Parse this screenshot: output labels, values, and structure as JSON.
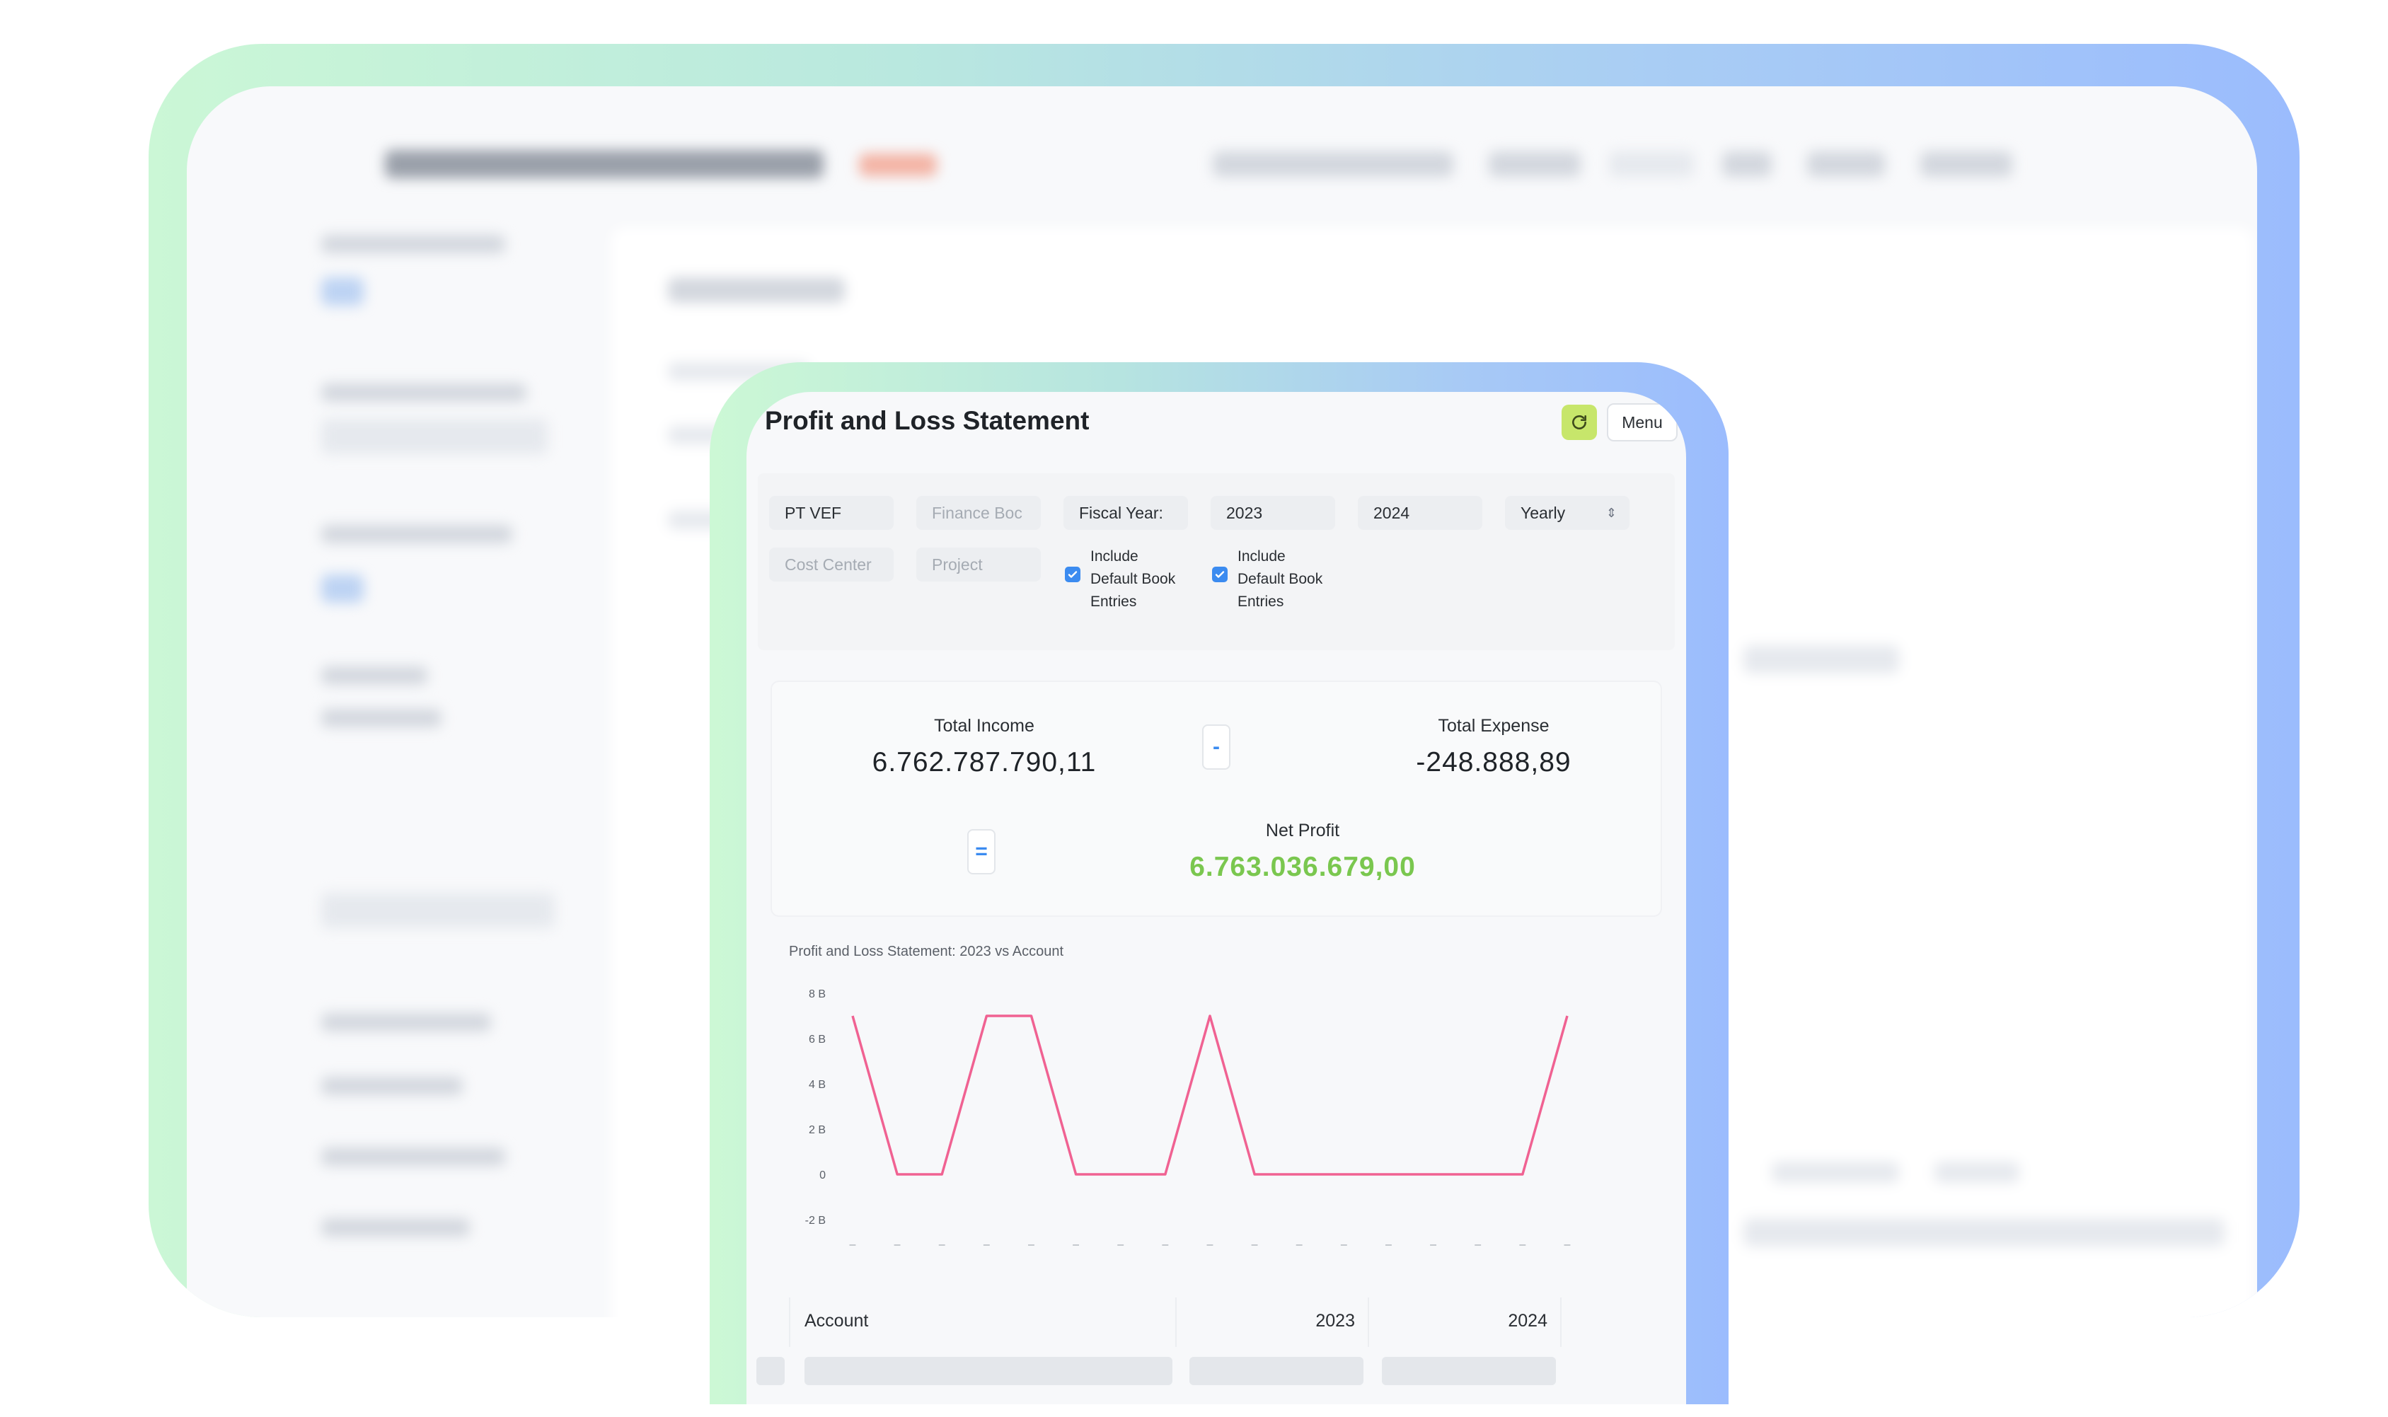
{
  "card": {
    "title": "Profit and Loss Statement",
    "menu_label": "Menu",
    "refresh_icon": "refresh-icon"
  },
  "filters": {
    "company": "PT VEF",
    "finance_book_placeholder": "Finance Boc",
    "period_type": "Fiscal Year:",
    "from_year": "2023",
    "to_year": "2024",
    "periodicity": "Yearly",
    "cost_center_placeholder": "Cost Center",
    "project_placeholder": "Project",
    "include_default_book_1": [
      "Include",
      "Default Book",
      "Entries"
    ],
    "include_default_book_2": [
      "Include",
      "Default Book",
      "Entries"
    ]
  },
  "summary": {
    "income_label": "Total Income",
    "income_value": "6.762.787.790,11",
    "minus_symbol": "-",
    "expense_label": "Total Expense",
    "expense_value": "-248.888,89",
    "equals_symbol": "=",
    "net_label": "Net Profit",
    "net_value": "6.763.036.679,00"
  },
  "chart_data": {
    "type": "line",
    "title": "Profit and Loss Statement: 2023 vs Account",
    "xlabel": "",
    "ylabel": "",
    "y_tick_labels": [
      "8 B",
      "6 B",
      "4 B",
      "2 B",
      "0",
      "-2 B"
    ],
    "y_ticks": [
      8,
      6,
      4,
      2,
      0,
      -2
    ],
    "ylim": [
      -2,
      8
    ],
    "x_tick_labels": [
      "–",
      "–",
      "–",
      "–",
      "–",
      "–",
      "–",
      "–",
      "–",
      "–",
      "–",
      "–",
      "–",
      "–",
      "–",
      "–",
      "–"
    ],
    "color": "#f06292",
    "series": [
      {
        "values": [
          7,
          0,
          0,
          7,
          7,
          0,
          0,
          0,
          7,
          0,
          0,
          0,
          0,
          0,
          0,
          0,
          7
        ]
      }
    ]
  },
  "table": {
    "col_account": "Account",
    "col_2023": "2023",
    "col_2024": "2024"
  }
}
